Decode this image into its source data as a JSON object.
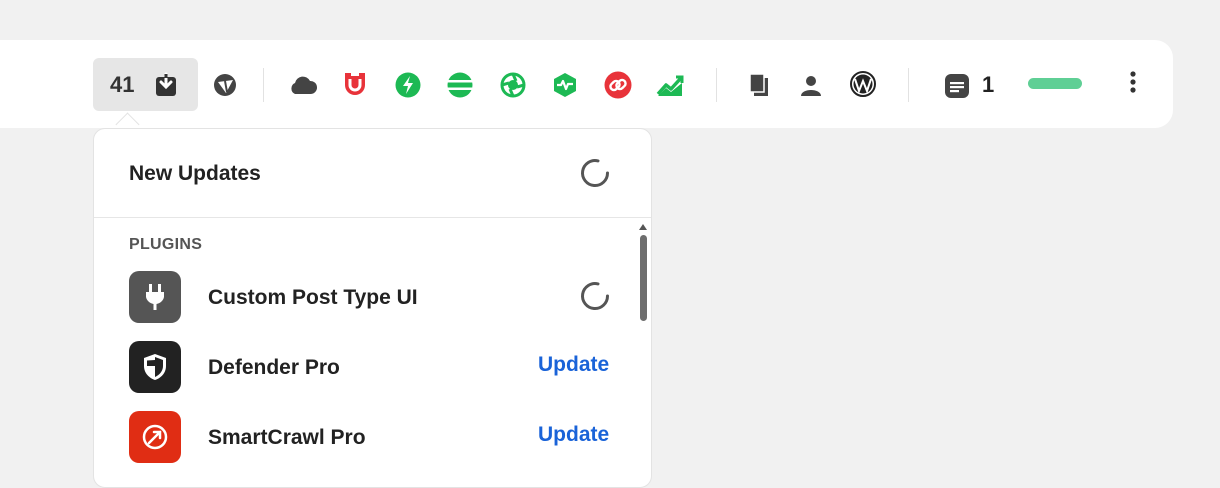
{
  "toolbar": {
    "updates_count": "41",
    "notifications_count": "1",
    "icons": {
      "download": "download-icon",
      "brand": "brand-icon",
      "cloud": "cloud-icon",
      "shield_badge": "branda-icon",
      "bolt": "hummingbird-icon",
      "lines": "forminator-icon",
      "aperture": "smush-icon",
      "pulse": "uptime-icon",
      "link": "broken-link-icon",
      "chart": "analytics-icon",
      "pages": "pages-icon",
      "user": "user-icon",
      "wordpress": "wordpress-icon",
      "notes": "notes-icon",
      "more": "more-icon"
    },
    "colors": {
      "green": "#1db954",
      "red": "#e8333a",
      "dark": "#444444",
      "progress": "#5fcf95"
    }
  },
  "dropdown": {
    "title": "New Updates",
    "section_label": "PLUGINS",
    "plugins": [
      {
        "name": "Custom Post Type UI",
        "status": "loading",
        "icon": "plug-icon",
        "icon_bg": "#555555"
      },
      {
        "name": "Defender Pro",
        "action": "Update",
        "icon": "shield-icon",
        "icon_bg": "#222222"
      },
      {
        "name": "SmartCrawl Pro",
        "action": "Update",
        "icon": "smartcrawl-icon",
        "icon_bg": "#e02d14"
      }
    ],
    "link_color": "#1a63d8"
  }
}
